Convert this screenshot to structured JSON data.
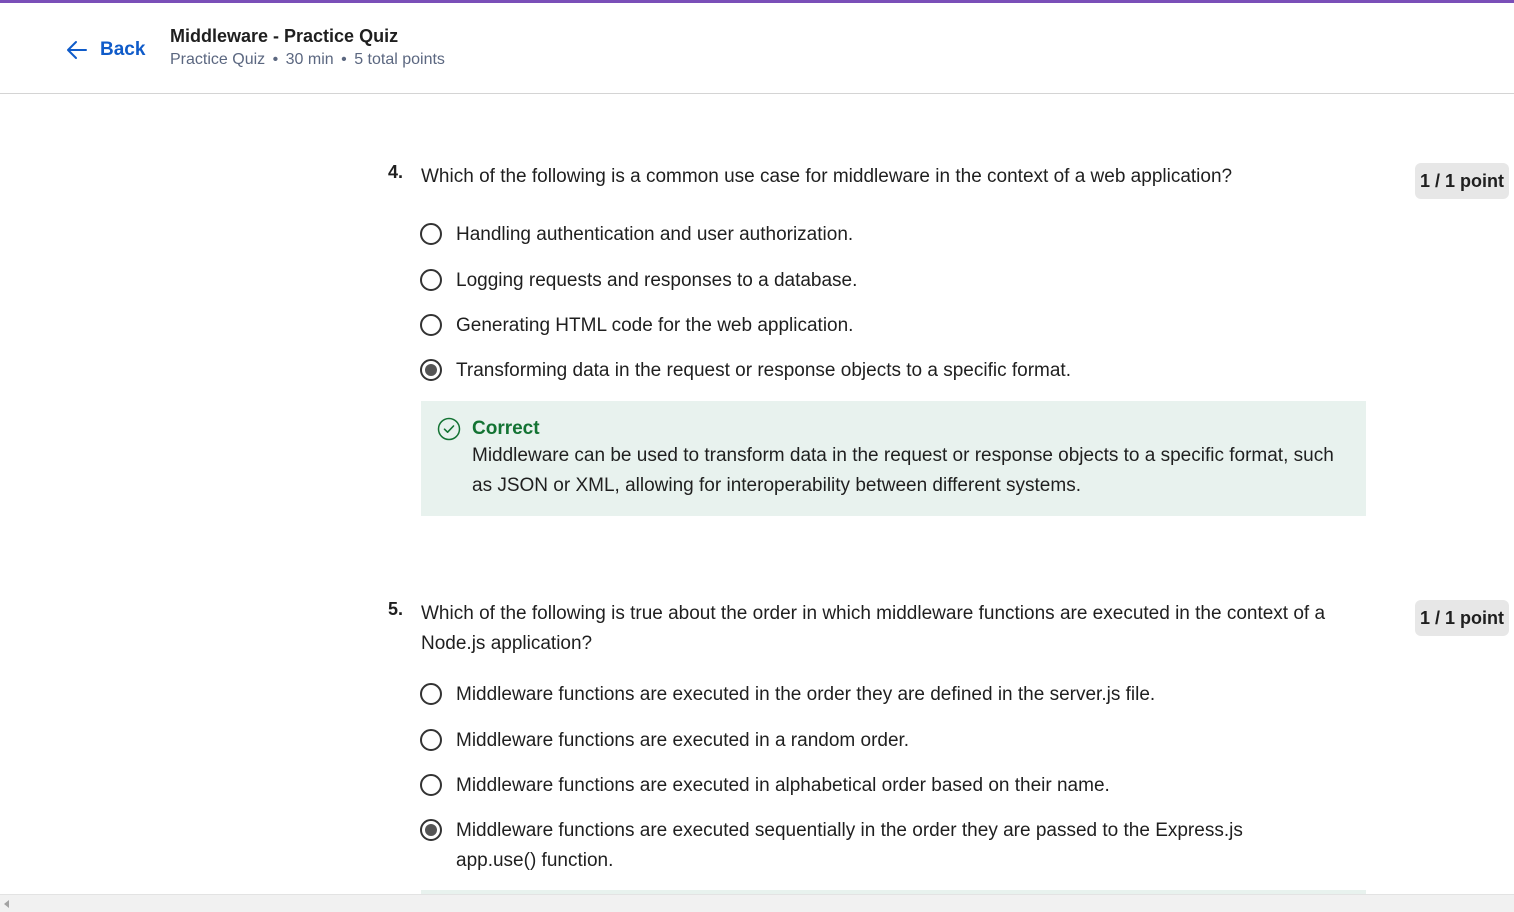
{
  "header": {
    "back_label": "Back",
    "title": "Middleware - Practice Quiz",
    "meta": {
      "type": "Practice Quiz",
      "duration": "30 min",
      "points": "5 total points",
      "separator": "•"
    }
  },
  "colors": {
    "accent_bar": "#7a4fb8",
    "link": "#0f5bc9",
    "correct": "#137333",
    "feedback_bg": "#e8f2ee"
  },
  "questions": [
    {
      "number": "4.",
      "text": "Which of the following is a common use case for middleware in the context of a web application?",
      "score": "1 / 1 point",
      "options": [
        {
          "label": "Handling authentication and user authorization.",
          "selected": false
        },
        {
          "label": "Logging requests and responses to a database.",
          "selected": false
        },
        {
          "label": "Generating HTML code for the web application.",
          "selected": false
        },
        {
          "label": "Transforming data in the request or response objects to a specific format.",
          "selected": true
        }
      ],
      "feedback": {
        "status": "Correct",
        "icon": "check-circle-icon",
        "text": "Middleware can be used to transform data in the request or response objects to a specific format, such as JSON or XML, allowing for interoperability between different systems."
      }
    },
    {
      "number": "5.",
      "text": "Which of the following is true about the order in which middleware functions are executed in the context of a Node.js application?",
      "score": "1 / 1 point",
      "options": [
        {
          "label": "Middleware functions are executed in the order they are defined in the server.js file.",
          "selected": false
        },
        {
          "label": "Middleware functions are executed in a random order.",
          "selected": false
        },
        {
          "label": "Middleware functions are executed in alphabetical order based on their name.",
          "selected": false
        },
        {
          "label": "Middleware functions are executed sequentially in the order they are passed to the Express.js app.use() function.",
          "selected": true
        }
      ]
    }
  ]
}
